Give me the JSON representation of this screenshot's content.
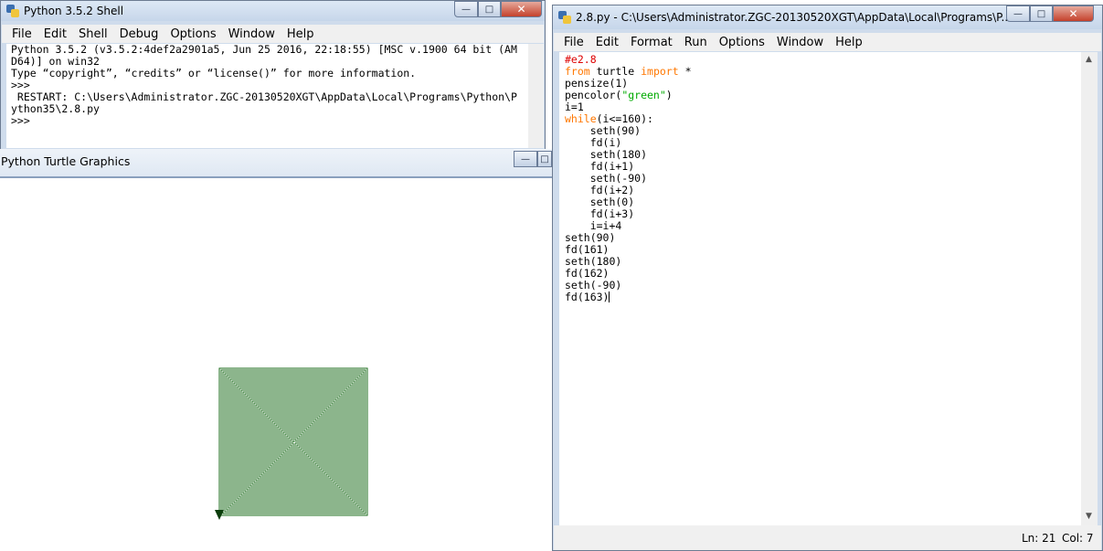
{
  "shell": {
    "title": "Python 3.5.2 Shell",
    "menu": [
      "File",
      "Edit",
      "Shell",
      "Debug",
      "Options",
      "Window",
      "Help"
    ],
    "lines": [
      "Python 3.5.2 (v3.5.2:4def2a2901a5, Jun 25 2016, 22:18:55) [MSC v.1900 64 bit (AM",
      "D64)] on win32",
      "Type “copyright”, “credits” or “license()” for more information.",
      ">>> ",
      " RESTART: C:\\Users\\Administrator.ZGC-20130520XGT\\AppData\\Local\\Programs\\Python\\P",
      "ython35\\2.8.py",
      ">>> "
    ]
  },
  "turtle": {
    "title": "Python Turtle Graphics",
    "pencolor": "#1a6b1a",
    "pensize": 1,
    "loop_limit": 160,
    "loop_step": 4,
    "final_segments": [
      161,
      162,
      163
    ]
  },
  "editor": {
    "title": "2.8.py - C:\\Users\\Administrator.ZGC-20130520XGT\\AppData\\Local\\Programs\\P...",
    "menu": [
      "File",
      "Edit",
      "Format",
      "Run",
      "Options",
      "Window",
      "Help"
    ],
    "code": {
      "l1": "#e2.8",
      "l2_from": "from",
      "l2_mod": " turtle ",
      "l2_import": "import",
      "l2_star": " *",
      "l3": "pensize(1)",
      "l4_a": "pencolor(",
      "l4_str": "\"green\"",
      "l4_b": ")",
      "l5": "i=1",
      "l6_kw": "while",
      "l6_rest": "(i<=160):",
      "l7": "    seth(90)",
      "l8": "    fd(i)",
      "l9": "    seth(180)",
      "l10": "    fd(i+1)",
      "l11": "    seth(-90)",
      "l12": "    fd(i+2)",
      "l13": "    seth(0)",
      "l14": "    fd(i+3)",
      "l15": "    i=i+4",
      "l16": "seth(90)",
      "l17": "fd(161)",
      "l18": "seth(180)",
      "l19": "fd(162)",
      "l20": "seth(-90)",
      "l21": "fd(163)"
    },
    "status": {
      "ln": "Ln: 21",
      "col": "Col: 7"
    }
  },
  "icons": {
    "minimize": "—",
    "maximize": "□",
    "close": "✕",
    "scroll_up": "▲",
    "scroll_down": "▼"
  }
}
